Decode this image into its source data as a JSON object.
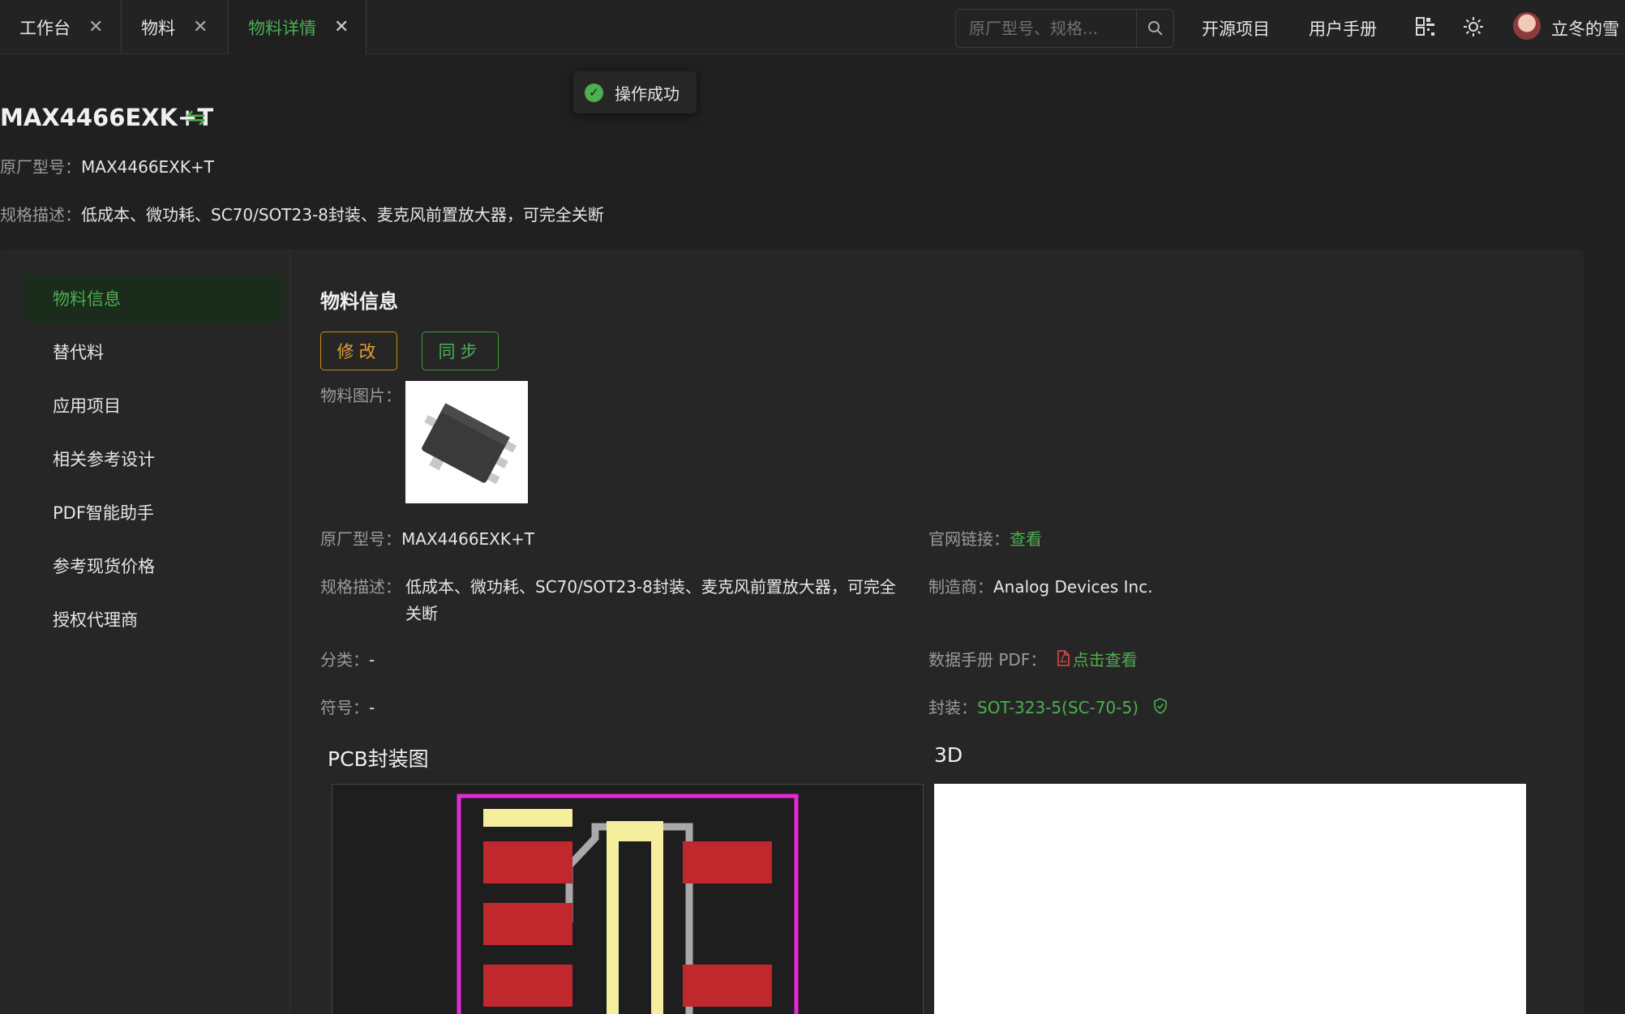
{
  "tabs": [
    {
      "label": "工作台"
    },
    {
      "label": "物料"
    },
    {
      "label": "物料详情"
    }
  ],
  "header": {
    "search_placeholder": "原厂型号、规格...",
    "links": [
      "开源项目",
      "用户手册"
    ],
    "username": "立冬的雪"
  },
  "toast": {
    "text": "操作成功"
  },
  "part": {
    "title": "MAX4466EXK+T",
    "mpn_label": "原厂型号：",
    "mpn": "MAX4466EXK+T",
    "desc_label": "规格描述：",
    "desc": "低成本、微功耗、SC70/SOT23-8封装、麦克风前置放大器，可完全关断"
  },
  "sidebar": {
    "items": [
      "物料信息",
      "替代料",
      "应用项目",
      "相关参考设计",
      "PDF智能助手",
      "参考现货价格",
      "授权代理商"
    ]
  },
  "detail": {
    "section_title": "物料信息",
    "edit_label": "修改",
    "sync_label": "同步",
    "image_label": "物料图片：",
    "mpn_label": "原厂型号：",
    "mpn": "MAX4466EXK+T",
    "desc_label": "规格描述：",
    "desc_line1": "低成本、微功耗、SC70/SOT23-8封装、麦克风前置放大器，可完全",
    "desc_line2": "关断",
    "category_label": "分类：",
    "category": "-",
    "symbol_label": "符号：",
    "symbol": "-",
    "website_label": "官网链接：",
    "website_link": "查看",
    "manufacturer_label": "制造商：",
    "manufacturer": "Analog Devices Inc.",
    "datasheet_label": "数据手册 PDF：",
    "datasheet_link": "点击查看",
    "package_label": "封装：",
    "package": "SOT-323-5(SC-70-5)",
    "pcb_title": "PCB封装图",
    "model_title": "3D"
  },
  "colors": {
    "accent": "#4caf50",
    "warning": "#e0a030",
    "pad": "#c0282d",
    "silk": "#f5ee9c",
    "outline": "#e829d8"
  }
}
